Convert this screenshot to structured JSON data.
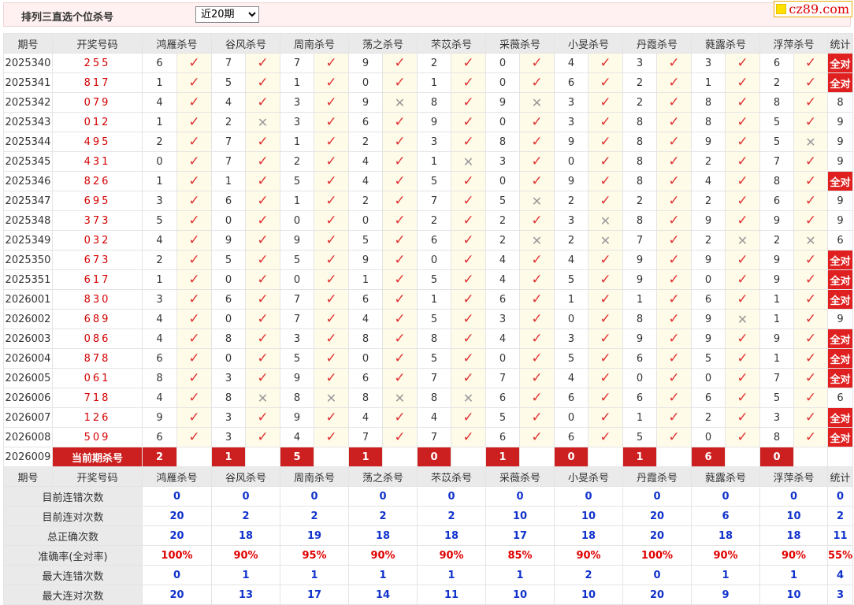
{
  "header": {
    "title": "排列三直选个位杀号",
    "select_value": "近20期",
    "select_options": [
      "近20期"
    ]
  },
  "brand": {
    "text": "cz89.com"
  },
  "columns": {
    "period": "期号",
    "number": "开奖号码",
    "stat": "统计",
    "experts": [
      "鸿雁杀号",
      "谷风杀号",
      "周南杀号",
      "荡之杀号",
      "芣苡杀号",
      "采薇杀号",
      "小旻杀号",
      "丹霞杀号",
      "蕤露杀号",
      "浮萍杀号"
    ]
  },
  "rows": [
    {
      "period": "2025340",
      "number": "255",
      "kills": [
        "6",
        "7",
        "7",
        "9",
        "2",
        "0",
        "4",
        "3",
        "3",
        "6"
      ],
      "marks": [
        1,
        1,
        1,
        1,
        1,
        1,
        1,
        1,
        1,
        1
      ],
      "stat": "全对"
    },
    {
      "period": "2025341",
      "number": "817",
      "kills": [
        "1",
        "5",
        "1",
        "0",
        "1",
        "0",
        "6",
        "2",
        "1",
        "2"
      ],
      "marks": [
        1,
        1,
        1,
        1,
        1,
        1,
        1,
        1,
        1,
        1
      ],
      "stat": "全对"
    },
    {
      "period": "2025342",
      "number": "079",
      "kills": [
        "4",
        "4",
        "3",
        "9",
        "8",
        "9",
        "3",
        "2",
        "8",
        "8"
      ],
      "marks": [
        1,
        1,
        1,
        0,
        1,
        0,
        1,
        1,
        1,
        1
      ],
      "stat": "8"
    },
    {
      "period": "2025343",
      "number": "012",
      "kills": [
        "1",
        "2",
        "3",
        "6",
        "9",
        "0",
        "3",
        "8",
        "8",
        "5"
      ],
      "marks": [
        1,
        0,
        1,
        1,
        1,
        1,
        1,
        1,
        1,
        1
      ],
      "stat": "9"
    },
    {
      "period": "2025344",
      "number": "495",
      "kills": [
        "2",
        "7",
        "1",
        "2",
        "3",
        "8",
        "9",
        "8",
        "9",
        "5"
      ],
      "marks": [
        1,
        1,
        1,
        1,
        1,
        1,
        1,
        1,
        1,
        0
      ],
      "stat": "9"
    },
    {
      "period": "2025345",
      "number": "431",
      "kills": [
        "0",
        "7",
        "2",
        "4",
        "1",
        "3",
        "0",
        "8",
        "2",
        "7"
      ],
      "marks": [
        1,
        1,
        1,
        1,
        0,
        1,
        1,
        1,
        1,
        1
      ],
      "stat": "9"
    },
    {
      "period": "2025346",
      "number": "826",
      "kills": [
        "1",
        "1",
        "5",
        "4",
        "5",
        "0",
        "9",
        "8",
        "4",
        "8"
      ],
      "marks": [
        1,
        1,
        1,
        1,
        1,
        1,
        1,
        1,
        1,
        1
      ],
      "stat": "全对"
    },
    {
      "period": "2025347",
      "number": "695",
      "kills": [
        "3",
        "6",
        "1",
        "2",
        "7",
        "5",
        "2",
        "2",
        "2",
        "6"
      ],
      "marks": [
        1,
        1,
        1,
        1,
        1,
        0,
        1,
        1,
        1,
        1
      ],
      "stat": "9"
    },
    {
      "period": "2025348",
      "number": "373",
      "kills": [
        "5",
        "0",
        "0",
        "0",
        "2",
        "2",
        "3",
        "8",
        "9",
        "9"
      ],
      "marks": [
        1,
        1,
        1,
        1,
        1,
        1,
        0,
        1,
        1,
        1
      ],
      "stat": "9"
    },
    {
      "period": "2025349",
      "number": "032",
      "kills": [
        "4",
        "9",
        "9",
        "5",
        "6",
        "2",
        "2",
        "7",
        "2",
        "2"
      ],
      "marks": [
        1,
        1,
        1,
        1,
        1,
        0,
        0,
        1,
        0,
        0
      ],
      "stat": "6"
    },
    {
      "period": "2025350",
      "number": "673",
      "kills": [
        "2",
        "5",
        "5",
        "9",
        "0",
        "4",
        "4",
        "9",
        "9",
        "9"
      ],
      "marks": [
        1,
        1,
        1,
        1,
        1,
        1,
        1,
        1,
        1,
        1
      ],
      "stat": "全对"
    },
    {
      "period": "2025351",
      "number": "617",
      "kills": [
        "1",
        "0",
        "0",
        "1",
        "5",
        "4",
        "5",
        "9",
        "0",
        "9"
      ],
      "marks": [
        1,
        1,
        1,
        1,
        1,
        1,
        1,
        1,
        1,
        1
      ],
      "stat": "全对"
    },
    {
      "period": "2026001",
      "number": "830",
      "kills": [
        "3",
        "6",
        "7",
        "6",
        "1",
        "6",
        "1",
        "1",
        "6",
        "1"
      ],
      "marks": [
        1,
        1,
        1,
        1,
        1,
        1,
        1,
        1,
        1,
        1
      ],
      "stat": "全对"
    },
    {
      "period": "2026002",
      "number": "689",
      "kills": [
        "4",
        "0",
        "7",
        "4",
        "5",
        "3",
        "0",
        "8",
        "9",
        "1"
      ],
      "marks": [
        1,
        1,
        1,
        1,
        1,
        1,
        1,
        1,
        0,
        1
      ],
      "stat": "9"
    },
    {
      "period": "2026003",
      "number": "086",
      "kills": [
        "4",
        "8",
        "3",
        "8",
        "8",
        "4",
        "3",
        "9",
        "9",
        "9"
      ],
      "marks": [
        1,
        1,
        1,
        1,
        1,
        1,
        1,
        1,
        1,
        1
      ],
      "stat": "全对"
    },
    {
      "period": "2026004",
      "number": "878",
      "kills": [
        "6",
        "0",
        "5",
        "0",
        "5",
        "0",
        "5",
        "6",
        "5",
        "1"
      ],
      "marks": [
        1,
        1,
        1,
        1,
        1,
        1,
        1,
        1,
        1,
        1
      ],
      "stat": "全对"
    },
    {
      "period": "2026005",
      "number": "061",
      "kills": [
        "8",
        "3",
        "9",
        "6",
        "7",
        "7",
        "4",
        "0",
        "0",
        "7"
      ],
      "marks": [
        1,
        1,
        1,
        1,
        1,
        1,
        1,
        1,
        1,
        1
      ],
      "stat": "全对"
    },
    {
      "period": "2026006",
      "number": "718",
      "kills": [
        "4",
        "8",
        "8",
        "8",
        "8",
        "6",
        "6",
        "6",
        "6",
        "5"
      ],
      "marks": [
        1,
        0,
        0,
        0,
        0,
        1,
        1,
        1,
        1,
        1
      ],
      "stat": "6"
    },
    {
      "period": "2026007",
      "number": "126",
      "kills": [
        "9",
        "3",
        "9",
        "4",
        "4",
        "5",
        "0",
        "1",
        "2",
        "3"
      ],
      "marks": [
        1,
        1,
        1,
        1,
        1,
        1,
        1,
        1,
        1,
        1
      ],
      "stat": "全对"
    },
    {
      "period": "2026008",
      "number": "509",
      "kills": [
        "6",
        "3",
        "4",
        "7",
        "7",
        "6",
        "6",
        "5",
        "0",
        "8"
      ],
      "marks": [
        1,
        1,
        1,
        1,
        1,
        1,
        1,
        1,
        1,
        1
      ],
      "stat": "全对"
    }
  ],
  "current": {
    "period": "2026009",
    "label": "当前期杀号",
    "kills": [
      "2",
      "1",
      "5",
      "1",
      "0",
      "1",
      "0",
      "1",
      "6",
      "0"
    ]
  },
  "stats": [
    {
      "label": "目前连错次数",
      "values": [
        "0",
        "0",
        "0",
        "0",
        "0",
        "0",
        "0",
        "0",
        "0",
        "0",
        "0"
      ]
    },
    {
      "label": "目前连对次数",
      "values": [
        "20",
        "2",
        "2",
        "2",
        "2",
        "10",
        "10",
        "20",
        "6",
        "10",
        "2"
      ]
    },
    {
      "label": "总正确次数",
      "values": [
        "20",
        "18",
        "19",
        "18",
        "18",
        "17",
        "18",
        "20",
        "18",
        "18",
        "11"
      ]
    },
    {
      "label": "准确率(全对率)",
      "values": [
        "100%",
        "90%",
        "95%",
        "90%",
        "90%",
        "85%",
        "90%",
        "100%",
        "90%",
        "90%",
        "55%"
      ]
    },
    {
      "label": "最大连错次数",
      "values": [
        "0",
        "1",
        "1",
        "1",
        "1",
        "1",
        "2",
        "0",
        "1",
        "1",
        "4"
      ]
    },
    {
      "label": "最大连对次数",
      "values": [
        "20",
        "13",
        "17",
        "14",
        "11",
        "10",
        "10",
        "20",
        "9",
        "10",
        "3"
      ]
    }
  ],
  "colors": {
    "check": "#e03333",
    "cross": "#999999",
    "all_correct_bg": "#e02020",
    "stat_value": "#1133cc",
    "accuracy_value": "#e00000",
    "current_row_bg": "#cc1f1f"
  },
  "icons": {
    "correct": "check-mark-icon",
    "wrong": "cross-mark-icon"
  }
}
